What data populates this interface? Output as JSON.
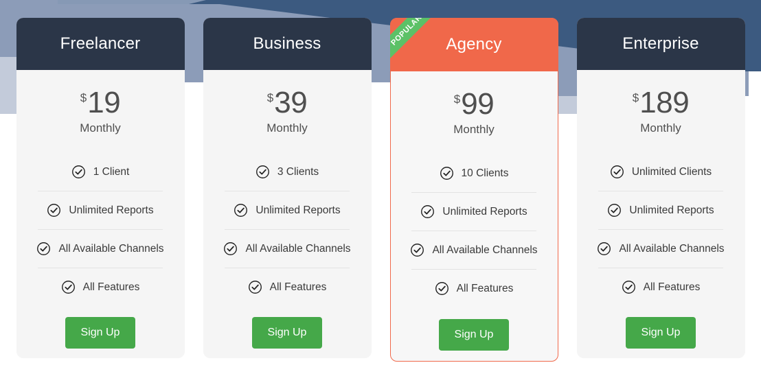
{
  "background": {
    "steel_blue": "#3c5a80",
    "slate_blue": "#8c9cb8",
    "pale_blue": "#c3cbda",
    "white": "#ffffff"
  },
  "theme": {
    "header_dark": "#2b3648",
    "featured_coral": "#f0684a",
    "ribbon_green": "#5cc167",
    "button_green": "#45a849",
    "card_bg": "#f5f5f5",
    "separator": "#e3e3e3",
    "price_text": "#4f4f4f",
    "feature_text": "#3a3a3a"
  },
  "plans": [
    {
      "name": "Freelancer",
      "featured": false,
      "ribbon": null,
      "currency": "$",
      "price": "19",
      "period": "Monthly",
      "features": [
        {
          "icon": "check-circle-icon",
          "label": "1 Client"
        },
        {
          "icon": "check-circle-icon",
          "label": "Unlimited Reports"
        },
        {
          "icon": "check-circle-icon",
          "label": "All Available Channels"
        },
        {
          "icon": "check-circle-icon",
          "label": "All Features"
        }
      ],
      "cta": "Sign Up"
    },
    {
      "name": "Business",
      "featured": false,
      "ribbon": null,
      "currency": "$",
      "price": "39",
      "period": "Monthly",
      "features": [
        {
          "icon": "check-circle-icon",
          "label": "3 Clients"
        },
        {
          "icon": "check-circle-icon",
          "label": "Unlimited Reports"
        },
        {
          "icon": "check-circle-icon",
          "label": "All Available Channels"
        },
        {
          "icon": "check-circle-icon",
          "label": "All Features"
        }
      ],
      "cta": "Sign Up"
    },
    {
      "name": "Agency",
      "featured": true,
      "ribbon": "POPULAR",
      "currency": "$",
      "price": "99",
      "period": "Monthly",
      "features": [
        {
          "icon": "check-circle-icon",
          "label": "10 Clients"
        },
        {
          "icon": "check-circle-icon",
          "label": "Unlimited Reports"
        },
        {
          "icon": "check-circle-icon",
          "label": "All Available Channels"
        },
        {
          "icon": "check-circle-icon",
          "label": "All Features"
        }
      ],
      "cta": "Sign Up"
    },
    {
      "name": "Enterprise",
      "featured": false,
      "ribbon": null,
      "currency": "$",
      "price": "189",
      "period": "Monthly",
      "features": [
        {
          "icon": "check-circle-icon",
          "label": "Unlimited Clients"
        },
        {
          "icon": "check-circle-icon",
          "label": "Unlimited Reports"
        },
        {
          "icon": "check-circle-icon",
          "label": "All Available Channels"
        },
        {
          "icon": "check-circle-icon",
          "label": "All Features"
        }
      ],
      "cta": "Sign Up"
    }
  ]
}
